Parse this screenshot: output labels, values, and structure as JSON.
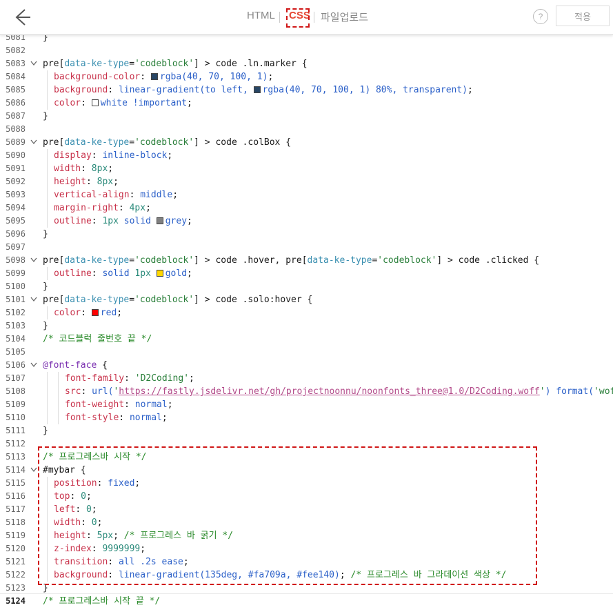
{
  "header": {
    "tabs": [
      {
        "label": "HTML"
      },
      {
        "label": "CSS"
      },
      {
        "label": "파일업로드"
      }
    ],
    "help_label": "?",
    "apply_label": "적용"
  },
  "editor": {
    "lines": [
      {
        "n": "5081",
        "t": [
          [
            "c",
            "}"
          ]
        ]
      },
      {
        "n": "5082",
        "t": []
      },
      {
        "n": "5083",
        "fold": true,
        "t": [
          [
            "s",
            "pre["
          ],
          [
            "a",
            "data-ke-type"
          ],
          [
            "s",
            "="
          ],
          [
            "g",
            "'codeblock'"
          ],
          [
            "s",
            "] > code .ln.marker {"
          ]
        ]
      },
      {
        "n": "5084",
        "i": 1,
        "t": [
          [
            "p",
            "background-color"
          ],
          [
            "s",
            ": "
          ],
          [
            "sw",
            "#284664"
          ],
          [
            "k",
            "rgba(40, 70, 100, 1)"
          ],
          [
            "s",
            ";"
          ]
        ]
      },
      {
        "n": "5085",
        "i": 1,
        "t": [
          [
            "p",
            "background"
          ],
          [
            "s",
            ": "
          ],
          [
            "k",
            "linear-gradient(to left, "
          ],
          [
            "sw",
            "#284664"
          ],
          [
            "k",
            "rgba(40, 70, 100, 1) 80%, transparent)"
          ],
          [
            "s",
            ";"
          ]
        ]
      },
      {
        "n": "5086",
        "i": 1,
        "t": [
          [
            "p",
            "color"
          ],
          [
            "s",
            ": "
          ],
          [
            "sw",
            "#ffffff"
          ],
          [
            "k",
            "white !important"
          ],
          [
            "s",
            ";"
          ]
        ]
      },
      {
        "n": "5087",
        "t": [
          [
            "s",
            "}"
          ]
        ]
      },
      {
        "n": "5088",
        "t": []
      },
      {
        "n": "5089",
        "fold": true,
        "t": [
          [
            "s",
            "pre["
          ],
          [
            "a",
            "data-ke-type"
          ],
          [
            "s",
            "="
          ],
          [
            "g",
            "'codeblock'"
          ],
          [
            "s",
            "] > code .colBox {"
          ]
        ]
      },
      {
        "n": "5090",
        "i": 1,
        "t": [
          [
            "p",
            "display"
          ],
          [
            "s",
            ": "
          ],
          [
            "k",
            "inline-block"
          ],
          [
            "s",
            ";"
          ]
        ]
      },
      {
        "n": "5091",
        "i": 1,
        "t": [
          [
            "p",
            "width"
          ],
          [
            "s",
            ": "
          ],
          [
            "m",
            "8px"
          ],
          [
            "s",
            ";"
          ]
        ]
      },
      {
        "n": "5092",
        "i": 1,
        "t": [
          [
            "p",
            "height"
          ],
          [
            "s",
            ": "
          ],
          [
            "m",
            "8px"
          ],
          [
            "s",
            ";"
          ]
        ]
      },
      {
        "n": "5093",
        "i": 1,
        "t": [
          [
            "p",
            "vertical-align"
          ],
          [
            "s",
            ": "
          ],
          [
            "k",
            "middle"
          ],
          [
            "s",
            ";"
          ]
        ]
      },
      {
        "n": "5094",
        "i": 1,
        "t": [
          [
            "p",
            "margin-right"
          ],
          [
            "s",
            ": "
          ],
          [
            "m",
            "4px"
          ],
          [
            "s",
            ";"
          ]
        ]
      },
      {
        "n": "5095",
        "i": 1,
        "t": [
          [
            "p",
            "outline"
          ],
          [
            "s",
            ": "
          ],
          [
            "m",
            "1px"
          ],
          [
            "k",
            " solid "
          ],
          [
            "sw",
            "#808080"
          ],
          [
            "k",
            "grey"
          ],
          [
            "s",
            ";"
          ]
        ]
      },
      {
        "n": "5096",
        "t": [
          [
            "s",
            "}"
          ]
        ]
      },
      {
        "n": "5097",
        "t": []
      },
      {
        "n": "5098",
        "fold": true,
        "t": [
          [
            "s",
            "pre["
          ],
          [
            "a",
            "data-ke-type"
          ],
          [
            "s",
            "="
          ],
          [
            "g",
            "'codeblock'"
          ],
          [
            "s",
            "] > code .hover, pre["
          ],
          [
            "a",
            "data-ke-type"
          ],
          [
            "s",
            "="
          ],
          [
            "g",
            "'codeblock'"
          ],
          [
            "s",
            "] > code .clicked {"
          ]
        ]
      },
      {
        "n": "5099",
        "i": 1,
        "t": [
          [
            "p",
            "outline"
          ],
          [
            "s",
            ": "
          ],
          [
            "k",
            "solid "
          ],
          [
            "m",
            "1px"
          ],
          [
            "s",
            " "
          ],
          [
            "sw",
            "#ffd700"
          ],
          [
            "k",
            "gold"
          ],
          [
            "s",
            ";"
          ]
        ]
      },
      {
        "n": "5100",
        "t": [
          [
            "s",
            "}"
          ]
        ]
      },
      {
        "n": "5101",
        "fold": true,
        "t": [
          [
            "s",
            "pre["
          ],
          [
            "a",
            "data-ke-type"
          ],
          [
            "s",
            "="
          ],
          [
            "g",
            "'codeblock'"
          ],
          [
            "s",
            "] > code .solo:hover {"
          ]
        ]
      },
      {
        "n": "5102",
        "i": 1,
        "t": [
          [
            "p",
            "color"
          ],
          [
            "s",
            ": "
          ],
          [
            "sw",
            "#ff0000"
          ],
          [
            "k",
            "red"
          ],
          [
            "s",
            ";"
          ]
        ]
      },
      {
        "n": "5103",
        "t": [
          [
            "s",
            "}"
          ]
        ]
      },
      {
        "n": "5104",
        "t": [
          [
            "cm",
            "/* 코드블럭 줄번호 끝 */"
          ]
        ]
      },
      {
        "n": "5105",
        "t": []
      },
      {
        "n": "5106",
        "fold": true,
        "t": [
          [
            "at",
            "@font-face"
          ],
          [
            "s",
            " {"
          ]
        ]
      },
      {
        "n": "5107",
        "i": 2,
        "t": [
          [
            "p",
            "font-family"
          ],
          [
            "s",
            ": "
          ],
          [
            "g",
            "'D2Coding'"
          ],
          [
            "s",
            ";"
          ]
        ]
      },
      {
        "n": "5108",
        "i": 2,
        "t": [
          [
            "p",
            "src"
          ],
          [
            "s",
            ": "
          ],
          [
            "k",
            "url("
          ],
          [
            "g",
            "'"
          ],
          [
            "u",
            "https://fastly.jsdelivr.net/gh/projectnoonnu/noonfonts_three@1.0/D2Coding.woff"
          ],
          [
            "g",
            "'"
          ],
          [
            "k",
            ") format("
          ],
          [
            "g",
            "'woff"
          ]
        ]
      },
      {
        "n": "5109",
        "i": 2,
        "t": [
          [
            "p",
            "font-weight"
          ],
          [
            "s",
            ": "
          ],
          [
            "k",
            "normal"
          ],
          [
            "s",
            ";"
          ]
        ]
      },
      {
        "n": "5110",
        "i": 2,
        "t": [
          [
            "p",
            "font-style"
          ],
          [
            "s",
            ": "
          ],
          [
            "k",
            "normal"
          ],
          [
            "s",
            ";"
          ]
        ]
      },
      {
        "n": "5111",
        "t": [
          [
            "s",
            "}"
          ]
        ]
      },
      {
        "n": "5112",
        "t": []
      },
      {
        "n": "5113",
        "t": [
          [
            "cm",
            "/* 프로그레스바 시작 */"
          ]
        ]
      },
      {
        "n": "5114",
        "fold": true,
        "t": [
          [
            "s",
            "#mybar {"
          ]
        ]
      },
      {
        "n": "5115",
        "i": 1,
        "t": [
          [
            "p",
            "position"
          ],
          [
            "s",
            ": "
          ],
          [
            "k",
            "fixed"
          ],
          [
            "s",
            ";"
          ]
        ]
      },
      {
        "n": "5116",
        "i": 1,
        "t": [
          [
            "p",
            "top"
          ],
          [
            "s",
            ": "
          ],
          [
            "m",
            "0"
          ],
          [
            "s",
            ";"
          ]
        ]
      },
      {
        "n": "5117",
        "i": 1,
        "t": [
          [
            "p",
            "left"
          ],
          [
            "s",
            ": "
          ],
          [
            "m",
            "0"
          ],
          [
            "s",
            ";"
          ]
        ]
      },
      {
        "n": "5118",
        "i": 1,
        "t": [
          [
            "p",
            "width"
          ],
          [
            "s",
            ": "
          ],
          [
            "m",
            "0"
          ],
          [
            "s",
            ";"
          ]
        ]
      },
      {
        "n": "5119",
        "i": 1,
        "t": [
          [
            "p",
            "height"
          ],
          [
            "s",
            ": "
          ],
          [
            "m",
            "5px"
          ],
          [
            "s",
            "; "
          ],
          [
            "cm",
            "/* 프로그레스 바 굵기 */"
          ]
        ]
      },
      {
        "n": "5120",
        "i": 1,
        "t": [
          [
            "p",
            "z-index"
          ],
          [
            "s",
            ": "
          ],
          [
            "m",
            "9999999"
          ],
          [
            "s",
            ";"
          ]
        ]
      },
      {
        "n": "5121",
        "i": 1,
        "t": [
          [
            "p",
            "transition"
          ],
          [
            "s",
            ": "
          ],
          [
            "k",
            "all .2s ease"
          ],
          [
            "s",
            ";"
          ]
        ]
      },
      {
        "n": "5122",
        "i": 1,
        "t": [
          [
            "p",
            "background"
          ],
          [
            "s",
            ": "
          ],
          [
            "k",
            "linear-gradient(135deg, #fa709a, #fee140)"
          ],
          [
            "s",
            "; "
          ],
          [
            "cm",
            "/* 프로그레스 바 그라데이션 색상 */"
          ]
        ]
      },
      {
        "n": "5123",
        "t": [
          [
            "s",
            "}"
          ]
        ]
      },
      {
        "n": "5124",
        "bold": true,
        "t": [
          [
            "cm",
            "/* 프로그레스바 시작 끝 */"
          ]
        ]
      }
    ]
  }
}
